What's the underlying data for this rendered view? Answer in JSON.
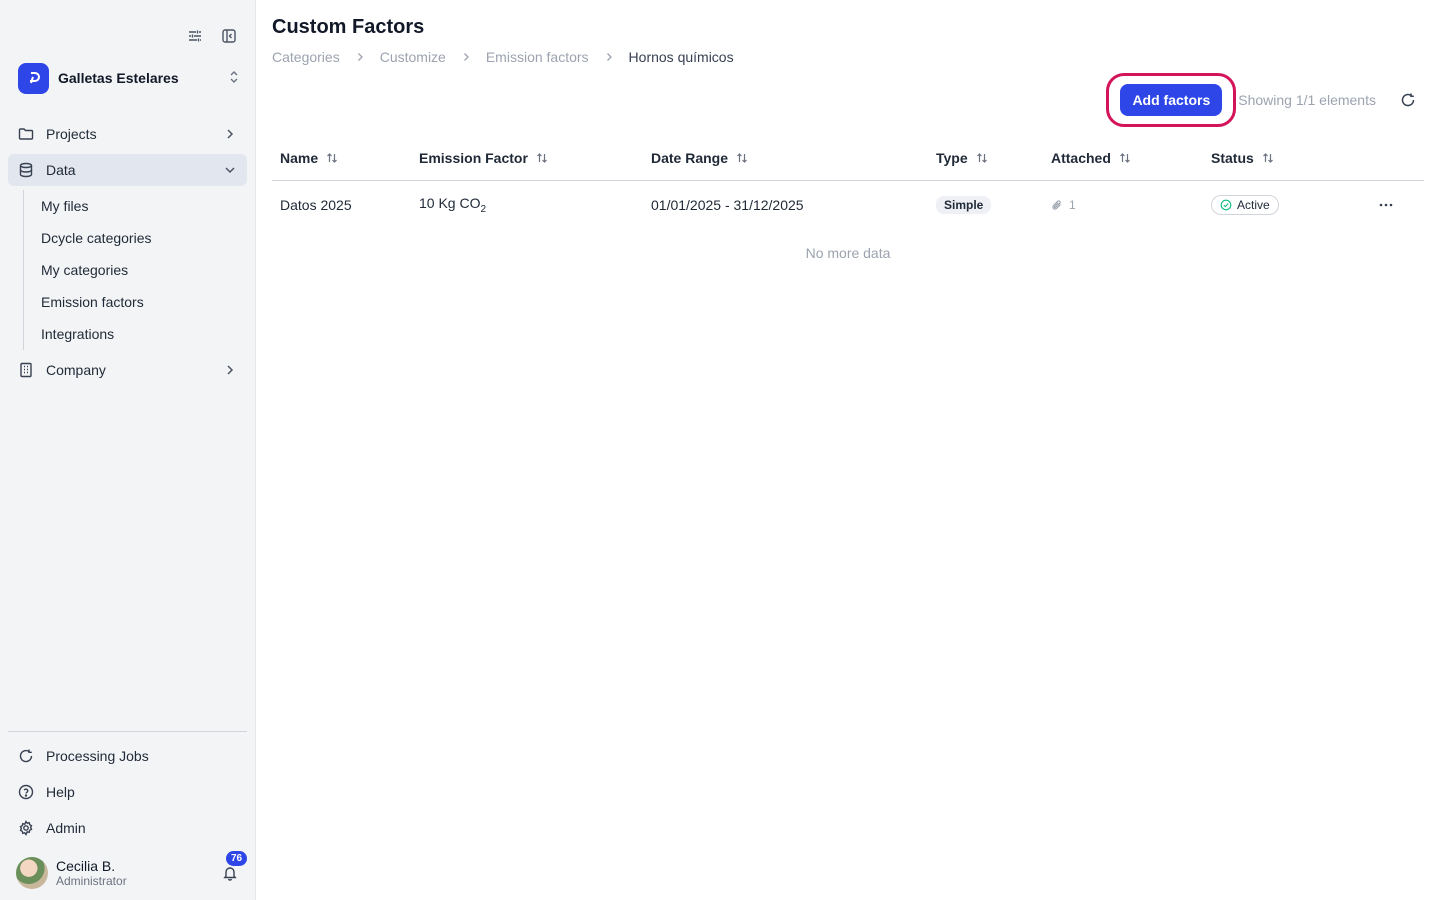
{
  "sidebar": {
    "org": {
      "name": "Galletas Estelares"
    },
    "nav": {
      "projects": "Projects",
      "data": "Data",
      "company": "Company"
    },
    "data_sub": [
      "My files",
      "Dcycle categories",
      "My categories",
      "Emission factors",
      "Integrations"
    ],
    "bottom": {
      "processing": "Processing Jobs",
      "help": "Help",
      "admin": "Admin"
    },
    "user": {
      "name": "Cecilia B.",
      "role": "Administrator",
      "notifications": "76"
    }
  },
  "main": {
    "title": "Custom Factors",
    "breadcrumb": [
      "Categories",
      "Customize",
      "Emission factors",
      "Hornos químicos"
    ],
    "add_button": "Add factors",
    "showing": "Showing 1/1 elements",
    "columns": [
      "Name",
      "Emission Factor",
      "Date Range",
      "Type",
      "Attached",
      "Status"
    ],
    "rows": [
      {
        "name": "Datos 2025",
        "ef_value": "10 Kg CO",
        "ef_sub": "2",
        "date_range": "01/01/2025 - 31/12/2025",
        "type": "Simple",
        "attached": "1",
        "status": "Active"
      }
    ],
    "no_more": "No more data"
  },
  "colors": {
    "accent": "#2e46e8",
    "highlight": "#d4145a",
    "status_active": "#10b981"
  }
}
